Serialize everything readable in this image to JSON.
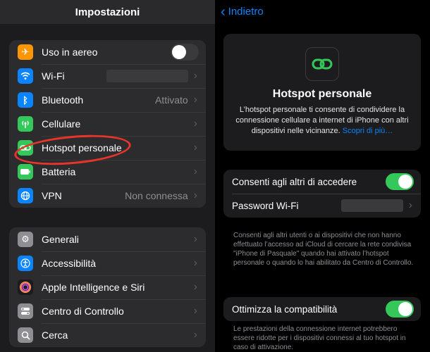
{
  "left": {
    "title": "Impostazioni",
    "group1": [
      {
        "label": "Uso in aereo",
        "value": "",
        "icon": "airplane-icon",
        "color": "#ff9500"
      },
      {
        "label": "Wi-Fi",
        "value": "",
        "icon": "wifi-icon",
        "color": "#0a84ff"
      },
      {
        "label": "Bluetooth",
        "value": "Attivato",
        "icon": "bluetooth-icon",
        "color": "#0a84ff"
      },
      {
        "label": "Cellulare",
        "value": "",
        "icon": "antenna-icon",
        "color": "#34c759"
      },
      {
        "label": "Hotspot personale",
        "value": "",
        "icon": "link-icon",
        "color": "#34c759"
      },
      {
        "label": "Batteria",
        "value": "",
        "icon": "battery-icon",
        "color": "#34c759"
      },
      {
        "label": "VPN",
        "value": "Non connessa",
        "icon": "globe-icon",
        "color": "#0a84ff"
      }
    ],
    "group2": [
      {
        "label": "Generali",
        "icon": "gear-icon",
        "color": "#8e8e93"
      },
      {
        "label": "Accessibilità",
        "icon": "accessibility-icon",
        "color": "#0a84ff"
      },
      {
        "label": "Apple Intelligence e Siri",
        "icon": "siri-icon",
        "color": "#bf5af2"
      },
      {
        "label": "Centro di Controllo",
        "icon": "toggles-icon",
        "color": "#8e8e93"
      },
      {
        "label": "Cerca",
        "icon": "search-icon",
        "color": "#8e8e93"
      }
    ],
    "airplane_mode_on": false
  },
  "right": {
    "back_label": "Indietro",
    "card_title": "Hotspot personale",
    "card_text": "L’hotspot personale ti consente di condividere la connessione cellulare a internet di iPhone con altri dispositivi nelle vicinanze.",
    "card_link": "Scopri di più…",
    "allow_label": "Consenti agli altri di accedere",
    "allow_on": true,
    "password_label": "Password Wi-Fi",
    "note1": "Consenti agli altri utenti o ai dispositivi che non hanno effettuato l’accesso ad iCloud di cercare la rete condivisa \"iPhone di Pasquale\" quando hai attivato l’hotspot personale o quando lo hai abilitato da Centro di Controllo.",
    "compat_label": "Ottimizza la compatibilità",
    "compat_on": true,
    "note2": "Le prestazioni della connessione internet potrebbero essere ridotte per i dispositivi connessi al tuo hotspot in caso di attivazione."
  },
  "colors": {
    "accent": "#0a84ff",
    "switch_on": "#34c759",
    "highlight_circle": "#e8352b"
  }
}
